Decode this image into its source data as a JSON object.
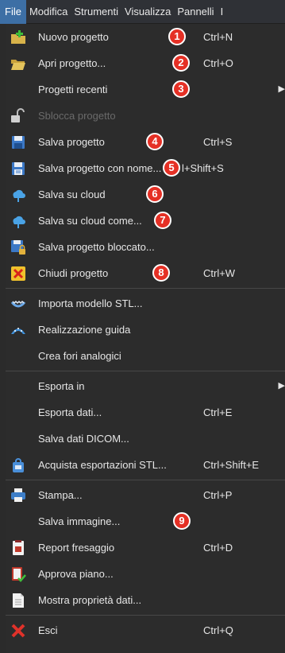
{
  "menubar": {
    "items": [
      "File",
      "Modifica",
      "Strumenti",
      "Visualizza",
      "Pannelli",
      "I"
    ]
  },
  "menu": {
    "items": [
      {
        "label": "Nuovo progetto",
        "shortcut": "Ctrl+N",
        "badge": "1",
        "icon": "new-project-icon"
      },
      {
        "label": "Apri progetto...",
        "shortcut": "Ctrl+O",
        "badge": "2",
        "icon": "open-folder-icon"
      },
      {
        "label": "Progetti recenti",
        "badge": "3",
        "submenu": "▶"
      },
      {
        "label": "Sblocca progetto",
        "disabled": true,
        "icon": "unlock-icon"
      },
      {
        "label": "Salva progetto",
        "shortcut": "Ctrl+S",
        "badge": "4",
        "icon": "save-icon"
      },
      {
        "label": "Salva progetto con nome...",
        "shortcut": "l+Shift+S",
        "badge": "5",
        "icon": "save-as-icon"
      },
      {
        "label": "Salva su cloud",
        "badge": "6",
        "icon": "cloud-save-icon"
      },
      {
        "label": "Salva su cloud come...",
        "badge": "7",
        "icon": "cloud-save-as-icon"
      },
      {
        "label": "Salva progetto bloccato...",
        "icon": "save-locked-icon"
      },
      {
        "label": "Chiudi progetto",
        "shortcut": "Ctrl+W",
        "badge": "8",
        "icon": "close-project-icon"
      },
      {
        "label": "Importa modello STL...",
        "icon": "import-stl-icon"
      },
      {
        "label": "Realizzazione guida",
        "icon": "guide-icon"
      },
      {
        "label": "Crea fori analogici"
      },
      {
        "label": "Esporta in",
        "submenu": "▶"
      },
      {
        "label": "Esporta dati...",
        "shortcut": "Ctrl+E"
      },
      {
        "label": "Salva dati DICOM..."
      },
      {
        "label": "Acquista esportazioni STL...",
        "shortcut": "Ctrl+Shift+E",
        "icon": "shop-bag-icon"
      },
      {
        "label": "Stampa...",
        "shortcut": "Ctrl+P",
        "icon": "printer-icon"
      },
      {
        "label": "Salva immagine...",
        "badge": "9"
      },
      {
        "label": "Report fresaggio",
        "shortcut": "Ctrl+D",
        "icon": "report-icon"
      },
      {
        "label": "Approva piano...",
        "icon": "approve-icon"
      },
      {
        "label": "Mostra proprietà dati...",
        "icon": "properties-icon"
      },
      {
        "label": "Esci",
        "shortcut": "Ctrl+Q",
        "icon": "exit-icon"
      }
    ]
  },
  "colors": {
    "accent": "#3d6fa5",
    "badge": "#e53025",
    "menu_bg": "#2c2c2c",
    "disabled_text": "#6a6a6a"
  }
}
